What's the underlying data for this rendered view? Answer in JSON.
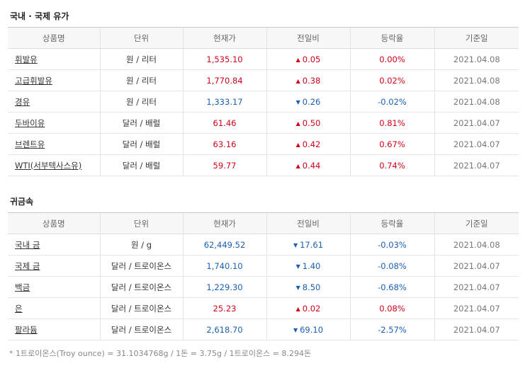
{
  "oil": {
    "title": "국내 · 국제 유가",
    "headers": [
      "상품명",
      "단위",
      "현재가",
      "전일비",
      "등락율",
      "기준일"
    ],
    "rows": [
      {
        "name": "휘발유",
        "unit": "원 / 리터",
        "price": "1,535.10",
        "dir": "up",
        "change": "0.05",
        "rate": "0.00%",
        "date": "2021.04.08"
      },
      {
        "name": "고급휘발유",
        "unit": "원 / 리터",
        "price": "1,770.84",
        "dir": "up",
        "change": "0.38",
        "rate": "0.02%",
        "date": "2021.04.08"
      },
      {
        "name": "경유",
        "unit": "원 / 리터",
        "price": "1,333.17",
        "dir": "down",
        "change": "0.26",
        "rate": "-0.02%",
        "date": "2021.04.08"
      },
      {
        "name": "두바이유",
        "unit": "달러 / 배럴",
        "price": "61.46",
        "dir": "up",
        "change": "0.50",
        "rate": "0.81%",
        "date": "2021.04.07"
      },
      {
        "name": "브렌트유",
        "unit": "달러 / 배럴",
        "price": "63.16",
        "dir": "up",
        "change": "0.42",
        "rate": "0.67%",
        "date": "2021.04.07"
      },
      {
        "name": "WTI(서부텍사스유)",
        "unit": "달러 / 배럴",
        "price": "59.77",
        "dir": "up",
        "change": "0.44",
        "rate": "0.74%",
        "date": "2021.04.07"
      }
    ]
  },
  "metal": {
    "title": "귀금속",
    "headers": [
      "상품명",
      "단위",
      "현재가",
      "전일비",
      "등락율",
      "기준일"
    ],
    "rows": [
      {
        "name": "국내 금",
        "unit": "원 / g",
        "price": "62,449.52",
        "dir": "down",
        "change": "17.61",
        "rate": "-0.03%",
        "date": "2021.04.08"
      },
      {
        "name": "국제 금",
        "unit": "달러 / 트로이온스",
        "price": "1,740.10",
        "dir": "down",
        "change": "1.40",
        "rate": "-0.08%",
        "date": "2021.04.07"
      },
      {
        "name": "백금",
        "unit": "달러 / 트로이온스",
        "price": "1,229.30",
        "dir": "down",
        "change": "8.50",
        "rate": "-0.68%",
        "date": "2021.04.07"
      },
      {
        "name": "은",
        "unit": "달러 / 트로이온스",
        "price": "25.23",
        "dir": "up",
        "change": "0.02",
        "rate": "0.08%",
        "date": "2021.04.07"
      },
      {
        "name": "팔라듐",
        "unit": "달러 / 트로이온스",
        "price": "2,618.70",
        "dir": "down",
        "change": "69.10",
        "rate": "-2.57%",
        "date": "2021.04.07"
      }
    ]
  },
  "footnote": "* 1트로이온스(Troy ounce) = 31.1034768g / 1돈 = 3.75g / 1트로이온스 = 8.294돈",
  "colors": {
    "up": "#d0021b",
    "down": "#1a5fb4"
  },
  "icons": {
    "up": "triangle-up-icon",
    "down": "triangle-down-icon"
  }
}
